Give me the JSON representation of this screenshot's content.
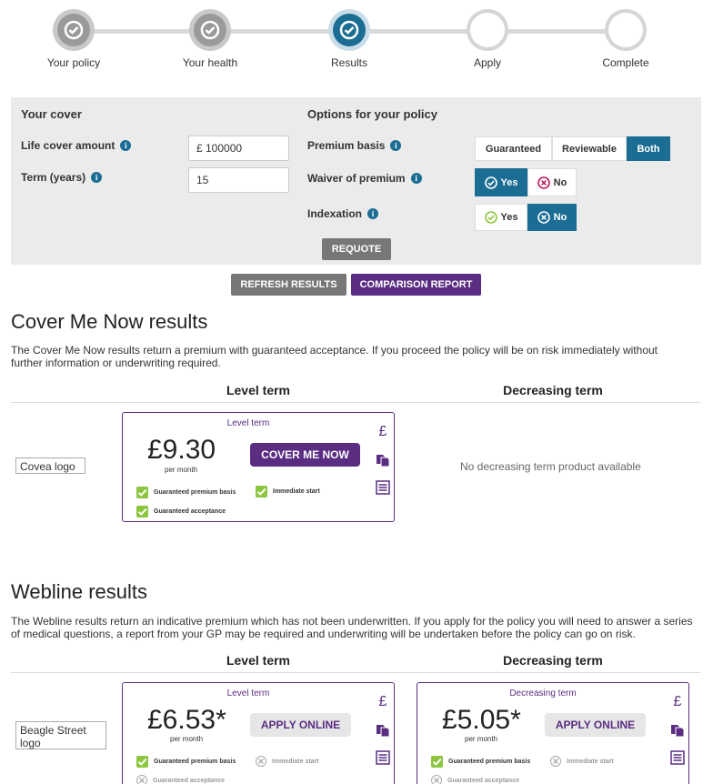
{
  "progress": {
    "steps": [
      {
        "label": "Your policy",
        "state": "done"
      },
      {
        "label": "Your health",
        "state": "done"
      },
      {
        "label": "Results",
        "state": "current"
      },
      {
        "label": "Apply",
        "state": "todo"
      },
      {
        "label": "Complete",
        "state": "todo"
      }
    ]
  },
  "cover": {
    "heading": "Your cover",
    "life_cover_label": "Life cover amount",
    "life_cover_value": "£ 100000",
    "term_label": "Term (years)",
    "term_value": "15"
  },
  "options": {
    "heading": "Options for your policy",
    "premium_basis_label": "Premium basis",
    "premium_basis": [
      "Guaranteed",
      "Reviewable",
      "Both"
    ],
    "premium_basis_selected": "Both",
    "waiver_label": "Waiver of premium",
    "waiver_yes": "Yes",
    "waiver_no": "No",
    "waiver_selected": "Yes",
    "indexation_label": "Indexation",
    "indexation_yes": "Yes",
    "indexation_no": "No",
    "indexation_selected": "No",
    "requote": "REQUOTE"
  },
  "actions": {
    "refresh": "REFRESH RESULTS",
    "comparison": "COMPARISON REPORT"
  },
  "cover_me_now": {
    "title": "Cover Me Now results",
    "description": "The Cover Me Now results return a premium with guaranteed acceptance. If you proceed the policy will be on risk immediately without further information or underwriting required.",
    "level_head": "Level term",
    "decreasing_head": "Decreasing term",
    "logo_alt": "Covea logo",
    "card": {
      "type": "Level term",
      "price": "£9.30",
      "per": "per month",
      "button": "COVER ME NOW",
      "features": [
        "Guaranteed premium basis",
        "Immediate start",
        "Guaranteed acceptance"
      ]
    },
    "no_decreasing": "No decreasing term product available"
  },
  "webline": {
    "title": "Webline results",
    "description": "The Webline results return an indicative premium which has not been underwritten. If you apply for the policy you will need to answer a series of medical questions, a report from your GP may be required and underwriting will be undertaken before the policy can go on risk.",
    "level_head": "Level term",
    "decreasing_head": "Decreasing term",
    "logo_alt": "Beagle Street logo",
    "level_card": {
      "type": "Level term",
      "price": "£6.53*",
      "per": "per month",
      "button": "APPLY ONLINE",
      "features": [
        "Guaranteed premium basis",
        "Immediate start",
        "Guaranteed acceptance"
      ]
    },
    "decreasing_card": {
      "type": "Decreasing term",
      "price": "£5.05*",
      "per": "per month",
      "button": "APPLY ONLINE",
      "features": [
        "Guaranteed premium basis",
        "Immediate start",
        "Guaranteed acceptance"
      ]
    }
  },
  "icons": {
    "pound": "£"
  },
  "colors": {
    "brand_blue": "#1b6d93",
    "brand_purple": "#5a2d82",
    "tick_green": "#8cc63f"
  }
}
